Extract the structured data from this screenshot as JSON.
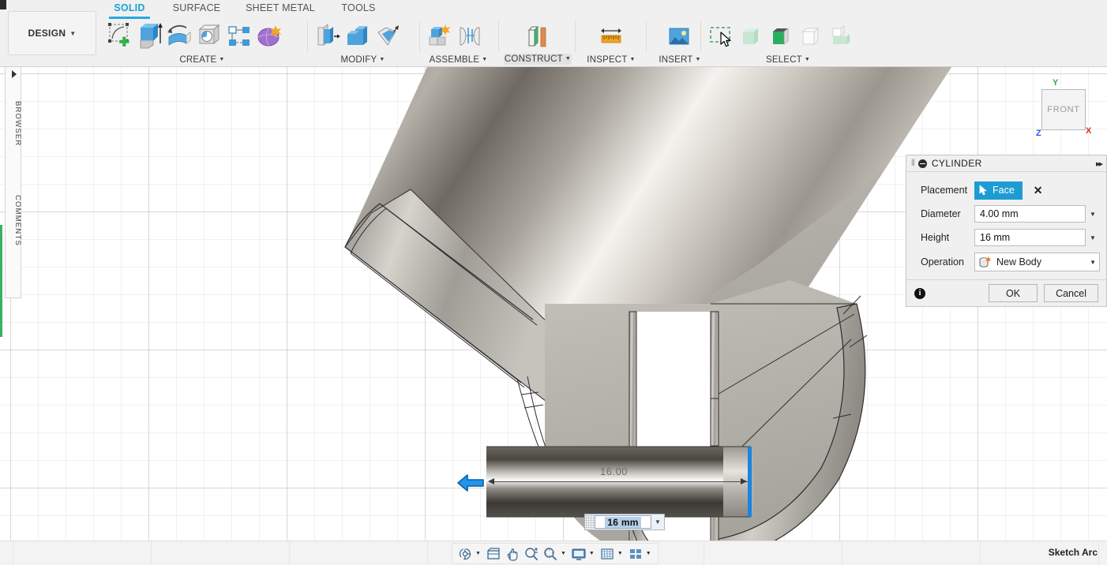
{
  "app": {
    "workspace_button": "DESIGN",
    "tabs": [
      {
        "label": "SOLID",
        "active": true
      },
      {
        "label": "SURFACE",
        "active": false
      },
      {
        "label": "SHEET METAL",
        "active": false
      },
      {
        "label": "TOOLS",
        "active": false
      }
    ],
    "panels": [
      {
        "label": "CREATE",
        "has_caret": true,
        "highlighted": false,
        "icons": [
          "create-sketch-icon",
          "extrude-icon",
          "revolve-icon",
          "hole-icon",
          "pattern-icon",
          "form-icon"
        ]
      },
      {
        "label": "MODIFY",
        "has_caret": true,
        "highlighted": false,
        "icons": [
          "press-pull-icon",
          "fillet-icon",
          "shell-icon"
        ]
      },
      {
        "label": "ASSEMBLE",
        "has_caret": true,
        "highlighted": false,
        "icons": [
          "new-component-icon",
          "joint-icon"
        ]
      },
      {
        "label": "CONSTRUCT",
        "has_caret": true,
        "highlighted": true,
        "icons": [
          "offset-plane-icon"
        ]
      },
      {
        "label": "INSPECT",
        "has_caret": true,
        "highlighted": false,
        "icons": [
          "measure-icon"
        ]
      },
      {
        "label": "INSERT",
        "has_caret": true,
        "highlighted": false,
        "icons": [
          "insert-image-icon"
        ]
      },
      {
        "label": "SELECT",
        "has_caret": true,
        "highlighted": false,
        "icons": [
          "select-window-icon",
          "select-paint-icon",
          "select-body-icon",
          "select-through-icon",
          "select-partial-icon"
        ]
      }
    ]
  },
  "left_dock": {
    "items": [
      {
        "label": "BROWSER"
      },
      {
        "label": "COMMENTS"
      }
    ]
  },
  "viewcube": {
    "face_label": "FRONT",
    "axes": [
      {
        "label": "Y",
        "color": "#2aa84a"
      },
      {
        "label": "X",
        "color": "#e02b2b"
      },
      {
        "label": "Z",
        "color": "#3355dd"
      }
    ]
  },
  "canvas": {
    "dimension_annotation": "16.00",
    "dimension_input_value": "16 mm",
    "manipulator_arrow": "flip-direction-arrow",
    "handle_color": "#1b84e0"
  },
  "dialog": {
    "title": "CYLINDER",
    "collapse_icon": "collapse-icon",
    "expand_icon": "expand-icon",
    "rows": [
      {
        "label": "Placement",
        "type": "select",
        "value": "Face",
        "clear_icon": "clear-selection-icon"
      },
      {
        "label": "Diameter",
        "type": "text",
        "value": "4.00 mm"
      },
      {
        "label": "Height",
        "type": "text",
        "value": "16 mm"
      },
      {
        "label": "Operation",
        "type": "dropdown",
        "value": "New Body",
        "icon": "new-body-icon"
      }
    ],
    "info_icon": "info-icon",
    "ok_label": "OK",
    "cancel_label": "Cancel",
    "accent_color": "#1f9bd4"
  },
  "bottom_bar": {
    "nav_icons": [
      {
        "name": "orbit-icon",
        "has_caret": true
      },
      {
        "name": "look-at-icon",
        "has_caret": false
      },
      {
        "name": "pan-icon",
        "has_caret": false
      },
      {
        "name": "zoom-icon",
        "has_caret": false
      },
      {
        "name": "fit-icon",
        "has_caret": true
      },
      {
        "name": "display-settings-icon",
        "has_caret": true
      },
      {
        "name": "grid-snap-icon",
        "has_caret": true
      },
      {
        "name": "viewports-icon",
        "has_caret": true
      }
    ],
    "status_text": "Sketch Arc"
  }
}
